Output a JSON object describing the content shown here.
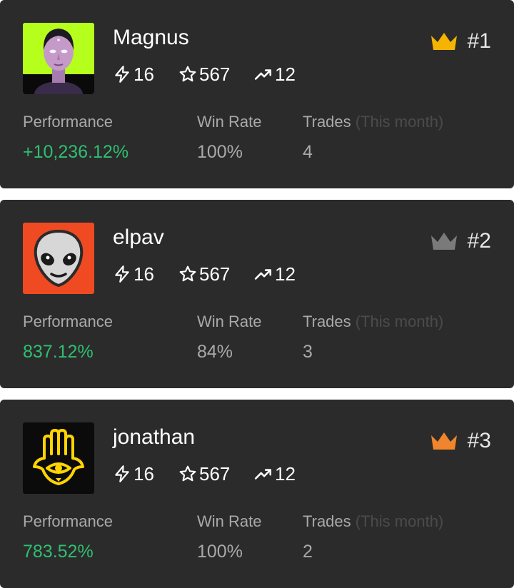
{
  "labels": {
    "performance": "Performance",
    "win_rate": "Win Rate",
    "trades": "Trades",
    "trades_period": "(This month)"
  },
  "colors": {
    "card_bg": "#2b2b2b",
    "positive": "#2fbf71",
    "crown_gold": "#f5b400",
    "crown_silver": "#7a7a7a",
    "crown_bronze": "#f0852d"
  },
  "traders": [
    {
      "username": "Magnus",
      "avatar": "portrait-avatar",
      "rank": "#1",
      "crown": "crown-gold-icon",
      "stats": {
        "bolt": "16",
        "star": "567",
        "trend": "12"
      },
      "performance": "+10,236.12%",
      "win_rate": "100%",
      "trades": "4"
    },
    {
      "username": "elpav",
      "avatar": "alien-avatar",
      "rank": "#2",
      "crown": "crown-silver-icon",
      "stats": {
        "bolt": "16",
        "star": "567",
        "trend": "12"
      },
      "performance": "837.12%",
      "win_rate": "84%",
      "trades": "3"
    },
    {
      "username": "jonathan",
      "avatar": "hamsa-avatar",
      "rank": "#3",
      "crown": "crown-bronze-icon",
      "stats": {
        "bolt": "16",
        "star": "567",
        "trend": "12"
      },
      "performance": "783.52%",
      "win_rate": "100%",
      "trades": "2"
    }
  ]
}
